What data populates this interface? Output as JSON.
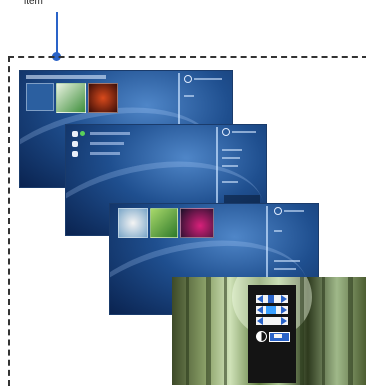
{
  "callout": {
    "label": "item"
  },
  "screen_menu_a": {
    "title": "",
    "side_label": ""
  },
  "screen_menu_b": {
    "rows": [
      "",
      "",
      ""
    ]
  },
  "colors": {
    "leader": "#2a63c8",
    "menu_bg": "#1f4f8f",
    "osd_bg": "#141414",
    "osd_accent": "#3aa0ff"
  },
  "icons": [
    "search-icon",
    "folder-icon",
    "contrast-icon",
    "arrow-left-icon",
    "arrow-right-icon"
  ]
}
